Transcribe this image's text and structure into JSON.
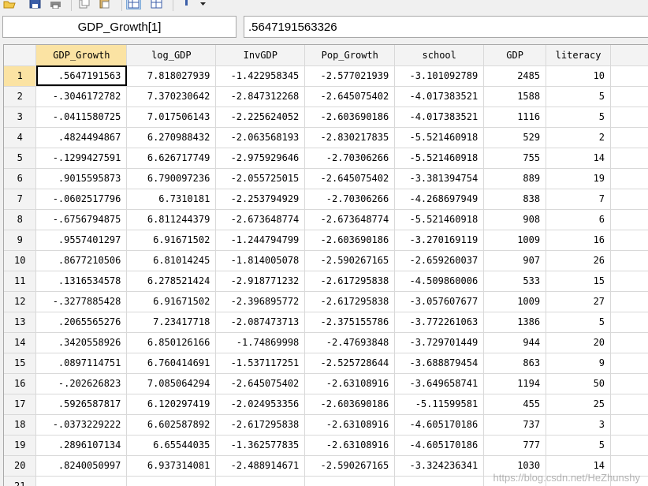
{
  "colors": {
    "selected_header": "#fbe3a3",
    "grid_line": "#d9d9d9",
    "header_bg": "#f3f3f3"
  },
  "toolbar": {
    "icons": [
      "open-icon",
      "save-icon",
      "print-icon",
      "copy-icon",
      "paste-icon",
      "browse-icon",
      "edit-icon",
      "filter-icon",
      "dropdown-icon"
    ]
  },
  "cell_ref": {
    "name": "GDP_Growth[1]",
    "value": ".5647191563326"
  },
  "grid": {
    "columns": [
      "GDP_Growth",
      "log_GDP",
      "InvGDP",
      "Pop_Growth",
      "school",
      "GDP",
      "literacy"
    ],
    "rows": [
      {
        "n": "1",
        "cells": [
          ".5647191563",
          "7.818027939",
          "-1.422958345",
          "-2.577021939",
          "-3.101092789",
          "2485",
          "10"
        ]
      },
      {
        "n": "2",
        "cells": [
          "-.3046172782",
          "7.370230642",
          "-2.847312268",
          "-2.645075402",
          "-4.017383521",
          "1588",
          "5"
        ]
      },
      {
        "n": "3",
        "cells": [
          "-.0411580725",
          "7.017506143",
          "-2.225624052",
          "-2.603690186",
          "-4.017383521",
          "1116",
          "5"
        ]
      },
      {
        "n": "4",
        "cells": [
          ".4824494867",
          "6.270988432",
          "-2.063568193",
          "-2.830217835",
          "-5.521460918",
          "529",
          "2"
        ]
      },
      {
        "n": "5",
        "cells": [
          "-.1299427591",
          "6.626717749",
          "-2.975929646",
          "-2.70306266",
          "-5.521460918",
          "755",
          "14"
        ]
      },
      {
        "n": "6",
        "cells": [
          ".9015595873",
          "6.790097236",
          "-2.055725015",
          "-2.645075402",
          "-3.381394754",
          "889",
          "19"
        ]
      },
      {
        "n": "7",
        "cells": [
          "-.0602517796",
          "6.7310181",
          "-2.253794929",
          "-2.70306266",
          "-4.268697949",
          "838",
          "7"
        ]
      },
      {
        "n": "8",
        "cells": [
          "-.6756794875",
          "6.811244379",
          "-2.673648774",
          "-2.673648774",
          "-5.521460918",
          "908",
          "6"
        ]
      },
      {
        "n": "9",
        "cells": [
          ".9557401297",
          "6.91671502",
          "-1.244794799",
          "-2.603690186",
          "-3.270169119",
          "1009",
          "16"
        ]
      },
      {
        "n": "10",
        "cells": [
          ".8677210506",
          "6.81014245",
          "-1.814005078",
          "-2.590267165",
          "-2.659260037",
          "907",
          "26"
        ]
      },
      {
        "n": "11",
        "cells": [
          ".1316534578",
          "6.278521424",
          "-2.918771232",
          "-2.617295838",
          "-4.509860006",
          "533",
          "15"
        ]
      },
      {
        "n": "12",
        "cells": [
          "-.3277885428",
          "6.91671502",
          "-2.396895772",
          "-2.617295838",
          "-3.057607677",
          "1009",
          "27"
        ]
      },
      {
        "n": "13",
        "cells": [
          ".2065565276",
          "7.23417718",
          "-2.087473713",
          "-2.375155786",
          "-3.772261063",
          "1386",
          "5"
        ]
      },
      {
        "n": "14",
        "cells": [
          ".3420558926",
          "6.850126166",
          "-1.74869998",
          "-2.47693848",
          "-3.729701449",
          "944",
          "20"
        ]
      },
      {
        "n": "15",
        "cells": [
          ".0897114751",
          "6.760414691",
          "-1.537117251",
          "-2.525728644",
          "-3.688879454",
          "863",
          "9"
        ]
      },
      {
        "n": "16",
        "cells": [
          "-.202626823",
          "7.085064294",
          "-2.645075402",
          "-2.63108916",
          "-3.649658741",
          "1194",
          "50"
        ]
      },
      {
        "n": "17",
        "cells": [
          ".5926587817",
          "6.120297419",
          "-2.024953356",
          "-2.603690186",
          "-5.11599581",
          "455",
          "25"
        ]
      },
      {
        "n": "18",
        "cells": [
          "-.0373229222",
          "6.602587892",
          "-2.617295838",
          "-2.63108916",
          "-4.605170186",
          "737",
          "3"
        ]
      },
      {
        "n": "19",
        "cells": [
          ".2896107134",
          "6.65544035",
          "-1.362577835",
          "-2.63108916",
          "-4.605170186",
          "777",
          "5"
        ]
      },
      {
        "n": "20",
        "cells": [
          ".8240050997",
          "6.937314081",
          "-2.488914671",
          "-2.590267165",
          "-3.324236341",
          "1030",
          "14"
        ]
      },
      {
        "n": "21",
        "cells": [
          "",
          "",
          "",
          "",
          "",
          "",
          ""
        ]
      }
    ]
  },
  "watermark": "https://blog.csdn.net/HeZhunshy"
}
